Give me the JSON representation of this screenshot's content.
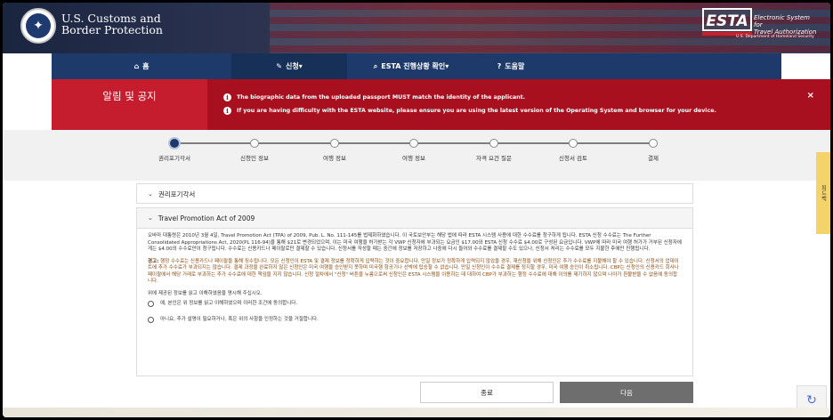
{
  "header": {
    "agency_line1": "U.S. Customs and",
    "agency_line2": "Border Protection",
    "esta_logo": "ESTA",
    "esta_sub_line1": "Electronic System for",
    "esta_sub_line2": "Travel Authorization",
    "esta_dept": "U.S. Department of Homeland Security"
  },
  "nav": {
    "items": [
      {
        "label": "홈",
        "icon": "home-icon",
        "glyph": "⌂"
      },
      {
        "label": "신청",
        "icon": "pencil-icon",
        "glyph": "✎",
        "active": true
      },
      {
        "label": "ESTA 진행상황 확인",
        "icon": "search-icon",
        "glyph": "⌕"
      },
      {
        "label": "도움말",
        "icon": "help-icon",
        "glyph": "?"
      }
    ]
  },
  "alert": {
    "title": "알림 및 공지",
    "messages": [
      "The biographic data from the uploaded passport MUST match the identity of the applicant.",
      "If you are having difficulty with the ESTA website, please ensure you are using the latest version of the Operating System and browser for your device."
    ],
    "close": "×"
  },
  "progress": {
    "steps": [
      "권리포기각서",
      "신청인 정보",
      "여행 정보",
      "여행 정보",
      "자격 요건 질문",
      "신청서 검토",
      "결제"
    ],
    "current_index": 0
  },
  "panels": {
    "waiver_title": "권리포기각서",
    "tpa_title": "Travel Promotion Act of 2009",
    "tpa_text": "오바마 대통령은 2010년 3월 4일, Travel Promotion Act (TPA) of 2009, Pub. L. No. 111-145를 법제화하였습니다. 이 국토보안부는 해당 법에 따라 ESTA 시스템 사용에 대한 수수료를 청구하게 됩니다. ESTA 신청 수수료는 The Further Consolidated Appropriations Act, 2020(PL 116-94)을 통해 $21로 변경되었으며, 이는 미국 여행을 허가받는 각 VWP 신청자에 부과되는 요금인 $17.00와 ESTA 신청 수수료 $4.00로 구성된 요금입니다. VWP에 따라 미국 여행 허가가 거부된 신청자에게는 $4.00의 수수료만이 청구됩니다. 수수료는 신용카드나 페이팔로만 결제할 수 있습니다. 신청서를 작성할 때는 중간에 정보를 저장하고 나중에 다시 들어와 수수료를 결제할 수도 있으나, 신청서 처리는 수수료를 모두 지불한 후에만 진행됩니다.",
    "warning_label": "경고:",
    "warning_text": " 행정 수수료는 신용카드나 페이팔을 통해 징수됩니다. 모든 신청인이 ESTA 및 결제 정보를 정확하게 입력하는 것이 중요합니다. 만일 정보가 정확하게 입력되지 않았을 경우, 재신청을 위해 신청인은 추가 수수료를 지불해야 할 수 있습니다. 신청서의 업데이트에 추가 수수료가 부과되지는 않습니다. 결제 과정을 완료하지 않은 신청인은 미국 여행을 승인받지 못하며 미국행 항공기나 선박에 탑승할 수 없습니다. 만일 신청인이 수수료 결제를 정지할 경우, 미국 여행 승인이 취소됩니다. CBP는 신청인의 신용카드 회사나 페이팔에서 해당 거래로 부과하는 추가 수수료에 대한 책임을 지지 않습니다. 신청 절차에서 \"신청\" 버튼을 누름으로써 신청인은 ESTA 시스템을 이용하는 데 대하여 CBP가 부과하는 행정 수수료에 대해 이의를 제기하지 않으며 나아가 환불받을 수 없음에 동의합니다.",
    "confirm_prompt": "위에 제공된 정보를 읽고 이해하였음을 명시해 주십시오.",
    "option_yes": "예, 본인은 위 정보를 읽고 이해하였으며 이러한 조건에 동의합니다.",
    "option_no": "아니요, 추가 설명이 필요하거나, 혹은 위의 사항을 인정하는 것을 거절합니다."
  },
  "buttons": {
    "cancel": "종료",
    "next": "다음"
  },
  "sidetab": "피드백"
}
